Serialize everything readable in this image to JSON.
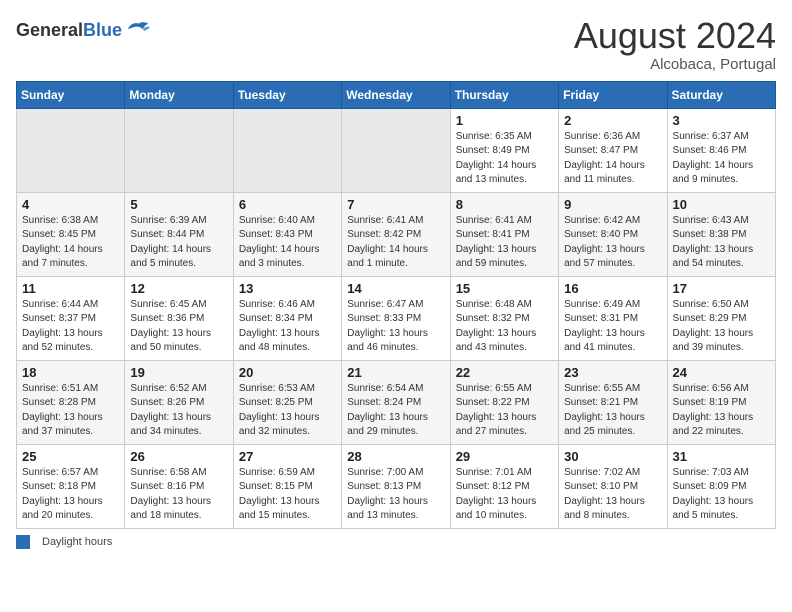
{
  "header": {
    "logo_line1": "General",
    "logo_line2": "Blue",
    "month_title": "August 2024",
    "subtitle": "Alcobaca, Portugal"
  },
  "weekdays": [
    "Sunday",
    "Monday",
    "Tuesday",
    "Wednesday",
    "Thursday",
    "Friday",
    "Saturday"
  ],
  "weeks": [
    [
      {
        "day": "",
        "info": ""
      },
      {
        "day": "",
        "info": ""
      },
      {
        "day": "",
        "info": ""
      },
      {
        "day": "",
        "info": ""
      },
      {
        "day": "1",
        "info": "Sunrise: 6:35 AM\nSunset: 8:49 PM\nDaylight: 14 hours\nand 13 minutes."
      },
      {
        "day": "2",
        "info": "Sunrise: 6:36 AM\nSunset: 8:47 PM\nDaylight: 14 hours\nand 11 minutes."
      },
      {
        "day": "3",
        "info": "Sunrise: 6:37 AM\nSunset: 8:46 PM\nDaylight: 14 hours\nand 9 minutes."
      }
    ],
    [
      {
        "day": "4",
        "info": "Sunrise: 6:38 AM\nSunset: 8:45 PM\nDaylight: 14 hours\nand 7 minutes."
      },
      {
        "day": "5",
        "info": "Sunrise: 6:39 AM\nSunset: 8:44 PM\nDaylight: 14 hours\nand 5 minutes."
      },
      {
        "day": "6",
        "info": "Sunrise: 6:40 AM\nSunset: 8:43 PM\nDaylight: 14 hours\nand 3 minutes."
      },
      {
        "day": "7",
        "info": "Sunrise: 6:41 AM\nSunset: 8:42 PM\nDaylight: 14 hours\nand 1 minute."
      },
      {
        "day": "8",
        "info": "Sunrise: 6:41 AM\nSunset: 8:41 PM\nDaylight: 13 hours\nand 59 minutes."
      },
      {
        "day": "9",
        "info": "Sunrise: 6:42 AM\nSunset: 8:40 PM\nDaylight: 13 hours\nand 57 minutes."
      },
      {
        "day": "10",
        "info": "Sunrise: 6:43 AM\nSunset: 8:38 PM\nDaylight: 13 hours\nand 54 minutes."
      }
    ],
    [
      {
        "day": "11",
        "info": "Sunrise: 6:44 AM\nSunset: 8:37 PM\nDaylight: 13 hours\nand 52 minutes."
      },
      {
        "day": "12",
        "info": "Sunrise: 6:45 AM\nSunset: 8:36 PM\nDaylight: 13 hours\nand 50 minutes."
      },
      {
        "day": "13",
        "info": "Sunrise: 6:46 AM\nSunset: 8:34 PM\nDaylight: 13 hours\nand 48 minutes."
      },
      {
        "day": "14",
        "info": "Sunrise: 6:47 AM\nSunset: 8:33 PM\nDaylight: 13 hours\nand 46 minutes."
      },
      {
        "day": "15",
        "info": "Sunrise: 6:48 AM\nSunset: 8:32 PM\nDaylight: 13 hours\nand 43 minutes."
      },
      {
        "day": "16",
        "info": "Sunrise: 6:49 AM\nSunset: 8:31 PM\nDaylight: 13 hours\nand 41 minutes."
      },
      {
        "day": "17",
        "info": "Sunrise: 6:50 AM\nSunset: 8:29 PM\nDaylight: 13 hours\nand 39 minutes."
      }
    ],
    [
      {
        "day": "18",
        "info": "Sunrise: 6:51 AM\nSunset: 8:28 PM\nDaylight: 13 hours\nand 37 minutes."
      },
      {
        "day": "19",
        "info": "Sunrise: 6:52 AM\nSunset: 8:26 PM\nDaylight: 13 hours\nand 34 minutes."
      },
      {
        "day": "20",
        "info": "Sunrise: 6:53 AM\nSunset: 8:25 PM\nDaylight: 13 hours\nand 32 minutes."
      },
      {
        "day": "21",
        "info": "Sunrise: 6:54 AM\nSunset: 8:24 PM\nDaylight: 13 hours\nand 29 minutes."
      },
      {
        "day": "22",
        "info": "Sunrise: 6:55 AM\nSunset: 8:22 PM\nDaylight: 13 hours\nand 27 minutes."
      },
      {
        "day": "23",
        "info": "Sunrise: 6:55 AM\nSunset: 8:21 PM\nDaylight: 13 hours\nand 25 minutes."
      },
      {
        "day": "24",
        "info": "Sunrise: 6:56 AM\nSunset: 8:19 PM\nDaylight: 13 hours\nand 22 minutes."
      }
    ],
    [
      {
        "day": "25",
        "info": "Sunrise: 6:57 AM\nSunset: 8:18 PM\nDaylight: 13 hours\nand 20 minutes."
      },
      {
        "day": "26",
        "info": "Sunrise: 6:58 AM\nSunset: 8:16 PM\nDaylight: 13 hours\nand 18 minutes."
      },
      {
        "day": "27",
        "info": "Sunrise: 6:59 AM\nSunset: 8:15 PM\nDaylight: 13 hours\nand 15 minutes."
      },
      {
        "day": "28",
        "info": "Sunrise: 7:00 AM\nSunset: 8:13 PM\nDaylight: 13 hours\nand 13 minutes."
      },
      {
        "day": "29",
        "info": "Sunrise: 7:01 AM\nSunset: 8:12 PM\nDaylight: 13 hours\nand 10 minutes."
      },
      {
        "day": "30",
        "info": "Sunrise: 7:02 AM\nSunset: 8:10 PM\nDaylight: 13 hours\nand 8 minutes."
      },
      {
        "day": "31",
        "info": "Sunrise: 7:03 AM\nSunset: 8:09 PM\nDaylight: 13 hours\nand 5 minutes."
      }
    ]
  ],
  "footer": {
    "legend_label": "Daylight hours"
  }
}
